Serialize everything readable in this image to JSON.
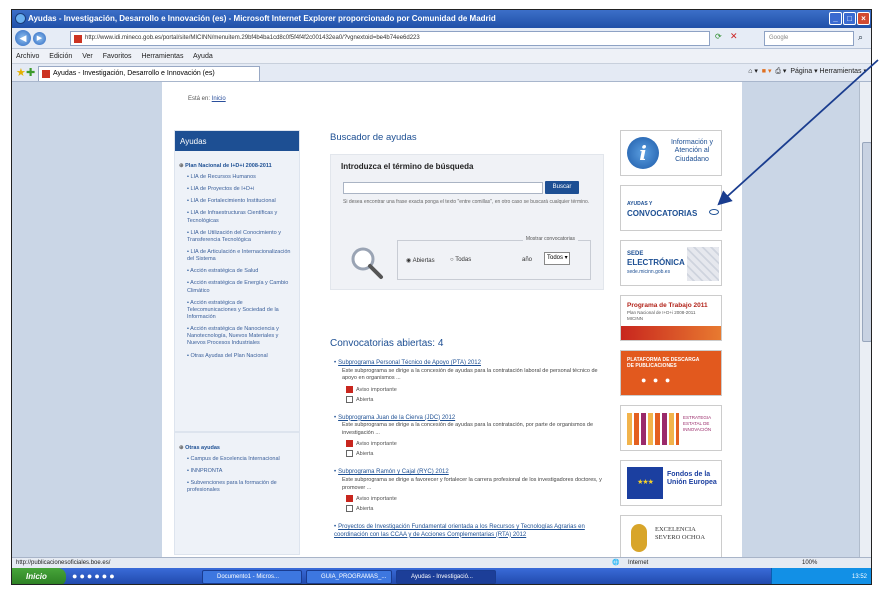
{
  "window": {
    "title": "Ayudas - Investigación, Desarrollo e Innovación (es) - Microsoft Internet Explorer proporcionado por Comunidad de Madrid",
    "url": "http://www.idi.mineco.gob.es/portal/site/MICINN/menuitem.29bf4b4ba1cd8c0f5f4f4f2c001432ea0/?vgnextoid=be4b74ee6d223",
    "search_placeholder": "Google",
    "menu": [
      "Archivo",
      "Edición",
      "Ver",
      "Favoritos",
      "Herramientas",
      "Ayuda"
    ],
    "tab_label": "Ayudas - Investigación, Desarrollo e Innovación (es)",
    "tools": "Página ▾  Herramientas ▾"
  },
  "page": {
    "breadcrumb_prefix": "Está en:",
    "breadcrumb_link": "Inicio",
    "left_title": "Ayudas",
    "plan_title": "Plan Nacional de I+D+i 2008-2011",
    "plan_items": [
      "LIA de Recursos Humanos",
      "LIA de Proyectos de I+D+i",
      "LIA de Fortalecimiento Institucional",
      "LIA de Infraestructuras Científicas y Tecnológicas",
      "LIA de Utilización del Conocimiento y Transferencia Tecnológica",
      "LIA de Articulación e Internacionalización del Sistema",
      "Acción estratégica de Salud",
      "Acción estratégica de Energía y Cambio Climático",
      "Acción estratégica de Telecomunicaciones y Sociedad de la Información",
      "Acción estratégica de Nanociencia y Nanotecnología, Nuevos Materiales y Nuevos Procesos Industriales",
      "Otras Ayudas del Plan Nacional"
    ],
    "other_title": "Otras ayudas",
    "other_items": [
      "Campus de Excelencia Internacional",
      "INNPRONTA",
      "Subvenciones para la formación de profesionales"
    ],
    "search_title": "Buscador de ayudas",
    "search_prompt": "Introduzca el término de búsqueda",
    "search_button": "Buscar",
    "search_hint": "Si desea encontrar una frase exacta ponga el texto \"entre comillas\", en otro caso se buscará cualquier término.",
    "filter_legend": "Mostrar convocatorias",
    "radio_open": "Abiertas",
    "radio_all": "Todas",
    "year_label": "año",
    "year_value": "Todos",
    "open_title": "Convocatorias abiertas: 4",
    "calls": [
      {
        "title": "Subprograma Personal Técnico de Apoyo (PTA) 2012",
        "desc": "Este subprograma se dirige a la concesión de ayudas para la contratación laboral de personal técnico de apoyo en organismos ...",
        "notice": "Aviso importante",
        "status": "Abierta"
      },
      {
        "title": "Subprograma Juan de la Cierva (JDC) 2012",
        "desc": "Este subprograma se dirige a la concesión de ayudas para la contratación, por parte de organismos de investigación ...",
        "notice": "Aviso importante",
        "status": "Abierta"
      },
      {
        "title": "Subprograma Ramón y Cajal (RYC) 2012",
        "desc": "Este subprograma se dirige a favorecer y fortalecer la carrera profesional de los investigadores doctores, y promover ...",
        "notice": "Aviso importante",
        "status": "Abierta"
      },
      {
        "title": "Proyectos de Investigación Fundamental orientada a los Recursos y Tecnologías Agrarias en coordinación con las CCAA y de Acciones Complementarias (RTA) 2012",
        "desc": "",
        "notice": "",
        "status": ""
      }
    ],
    "banners": {
      "info": "Información y Atención al Ciudadano",
      "ayudas_small": "AYUDAS Y",
      "ayudas_big": "CONVOCATORIAS",
      "sede_small": "SEDE",
      "sede_big": "ELECTRÓNICA",
      "sede_url": "sede.micinn.gob.es",
      "programa": "Programa de Trabajo 2011",
      "programa_sub": "Plan Nacional de I+D+i 2008-2011",
      "programa_sub2": "MICINN",
      "plataforma": "PLATAFORMA DE DESCARGA",
      "plataforma2": "DE PUBLICACIONES",
      "estrategia": "ESTRATEGIA ESTATAL DE INNOVACIÓN",
      "fondos": "Fondos de la Unión Europea",
      "excelencia": "EXCELENCIA SEVERO OCHOA"
    }
  },
  "status": {
    "url": "http://publicacionesoficiales.boe.es/",
    "zone": "Internet",
    "zoom": "100%"
  },
  "taskbar": {
    "start": "Inicio",
    "buttons": [
      "Documento1 - Micros...",
      "GUIA_PROGRAMAS_...",
      "Ayudas - Investigació..."
    ],
    "clock": "13:52"
  },
  "colors": {
    "brand_blue": "#1d4f93",
    "accent_red": "#c8261e",
    "annotation_arrow": "#1a3d8f"
  }
}
